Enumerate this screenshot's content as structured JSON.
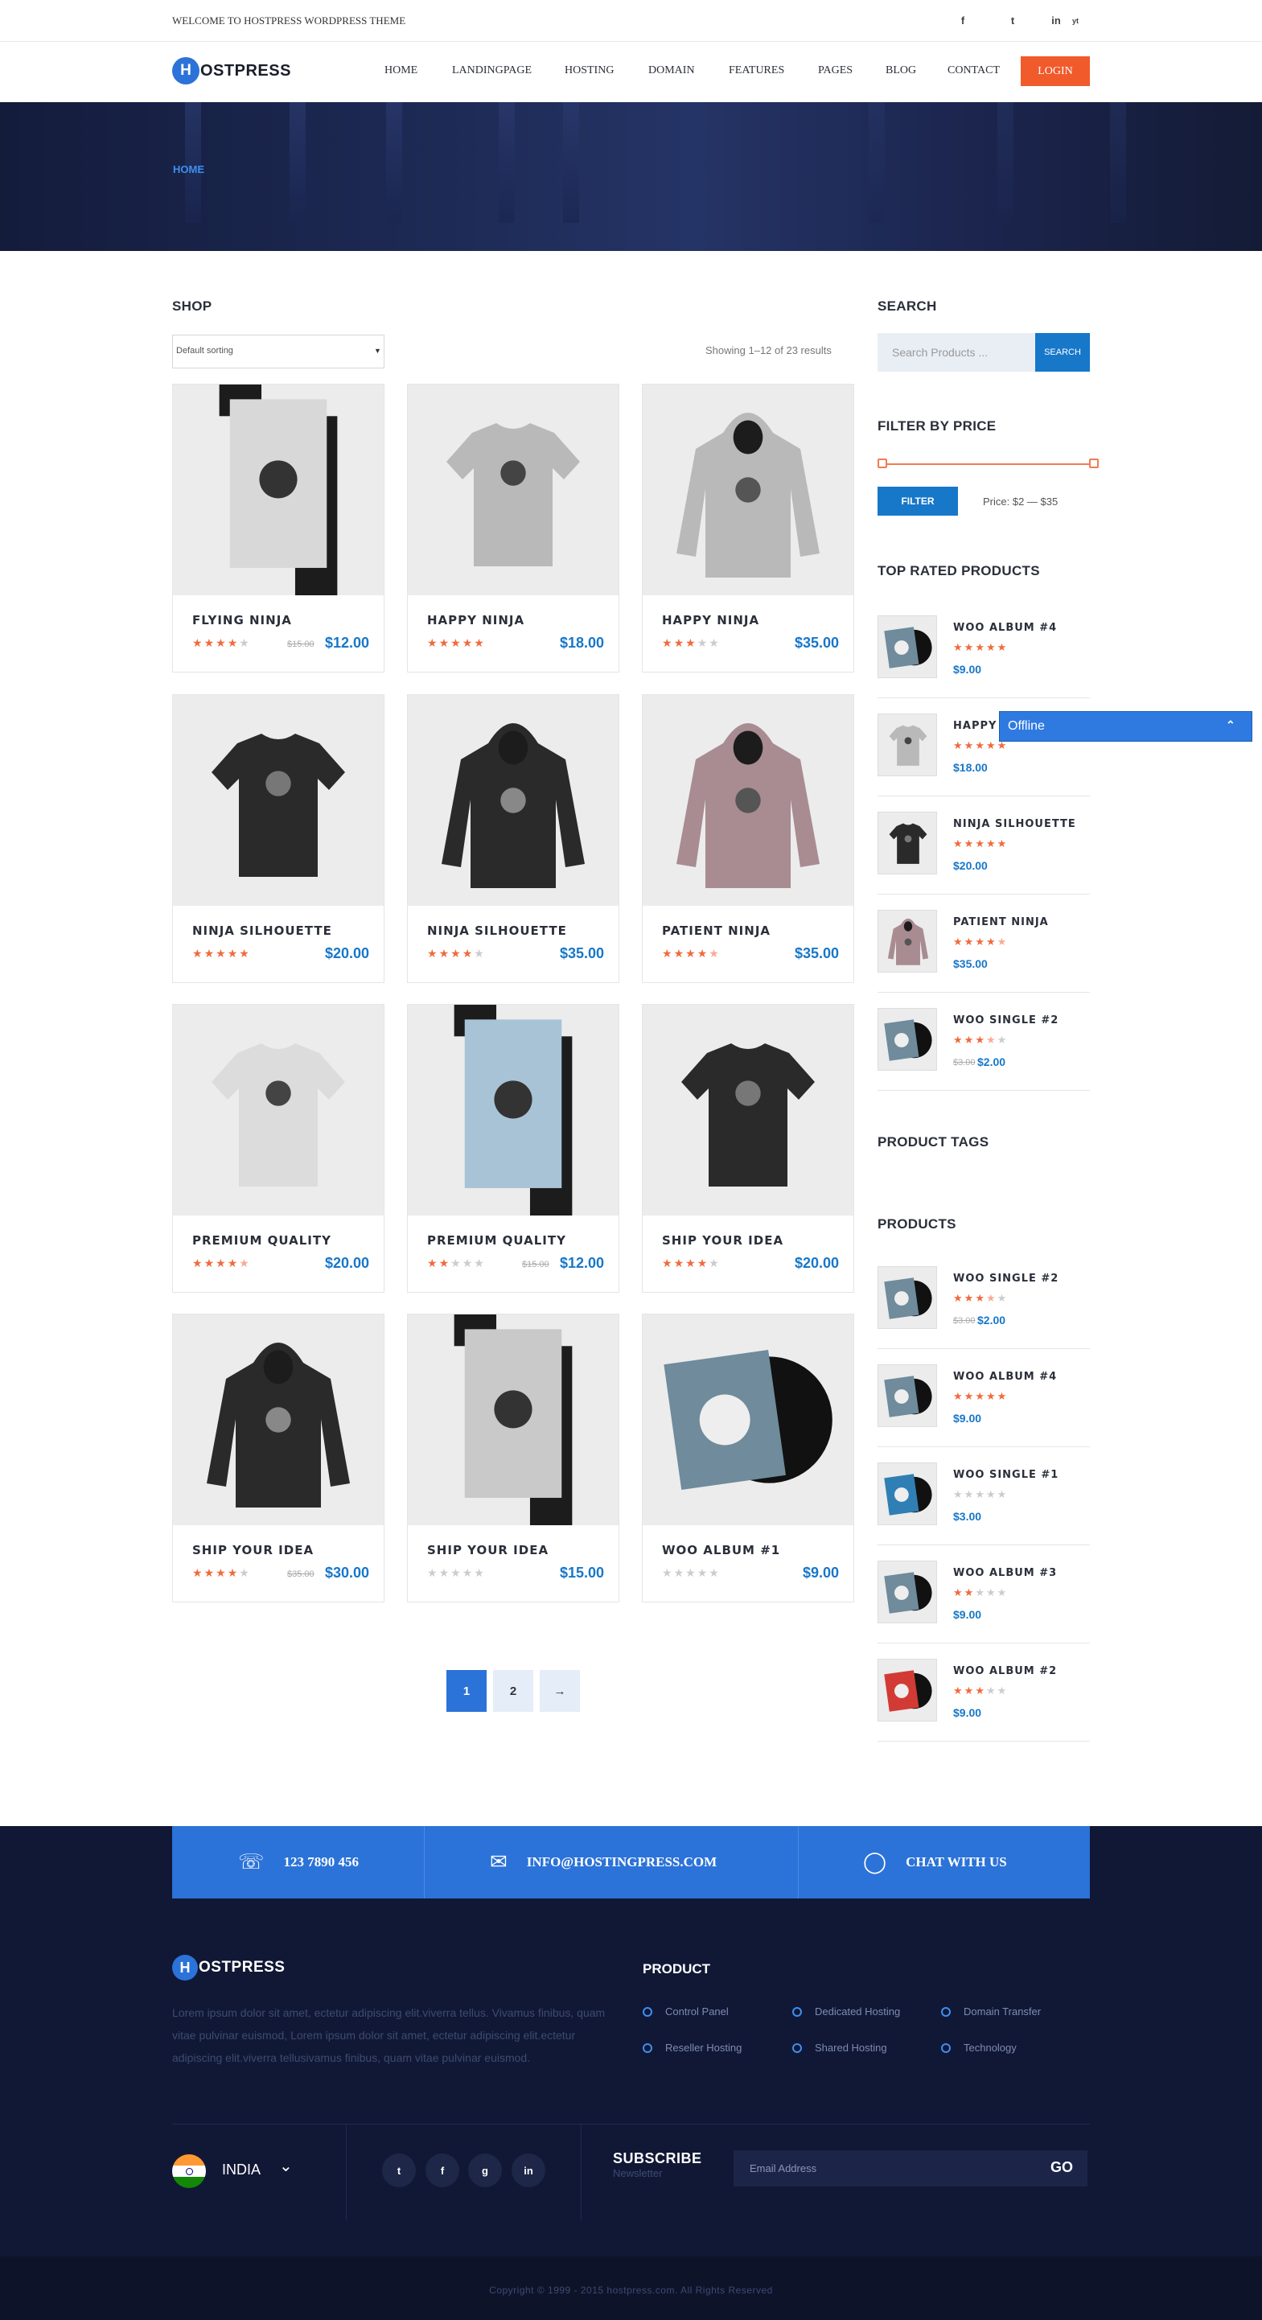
{
  "topbar": {
    "welcome": "WELCOME TO HOSTPRESS WORDPRESS THEME",
    "social": [
      "f",
      "t",
      "in",
      "yt"
    ]
  },
  "brand": {
    "initial": "H",
    "name": "OSTPRESS"
  },
  "nav": {
    "items": [
      "HOME",
      "LANDINGPAGE",
      "HOSTING",
      "DOMAIN",
      "FEATURES",
      "PAGES",
      "BLOG",
      "CONTACT"
    ],
    "login": "LOGIN"
  },
  "banner": {
    "breadcrumb": "HOME"
  },
  "shop": {
    "title": "SHOP",
    "sorting": "Default sorting",
    "showing": "Showing 1–12 of 23 results",
    "products": [
      {
        "name": "FLYING NINJA",
        "rating": 4,
        "old_price": "$15.00",
        "price": "$12.00",
        "image": "poster-ninja"
      },
      {
        "name": "HAPPY NINJA",
        "rating": 5,
        "old_price": "",
        "price": "$18.00",
        "image": "tshirt-grey"
      },
      {
        "name": "HAPPY NINJA",
        "rating": 3,
        "old_price": "",
        "price": "$35.00",
        "image": "hoodie-grey"
      },
      {
        "name": "NINJA SILHOUETTE",
        "rating": 5,
        "old_price": "",
        "price": "$20.00",
        "image": "tshirt-black"
      },
      {
        "name": "NINJA SILHOUETTE",
        "rating": 4,
        "old_price": "",
        "price": "$35.00",
        "image": "hoodie-black"
      },
      {
        "name": "PATIENT NINJA",
        "rating": 4.5,
        "old_price": "",
        "price": "$35.00",
        "image": "hoodie-pink"
      },
      {
        "name": "PREMIUM QUALITY",
        "rating": 4.5,
        "old_price": "",
        "price": "$20.00",
        "image": "tshirt-white"
      },
      {
        "name": "PREMIUM QUALITY",
        "rating": 2,
        "old_price": "$15.00",
        "price": "$12.00",
        "image": "poster-blue"
      },
      {
        "name": "SHIP YOUR IDEA",
        "rating": 4,
        "old_price": "",
        "price": "$20.00",
        "image": "tshirt-black-skull"
      },
      {
        "name": "SHIP YOUR IDEA",
        "rating": 4,
        "old_price": "$35.00",
        "price": "$30.00",
        "image": "hoodie-black-skull"
      },
      {
        "name": "SHIP YOUR IDEA",
        "rating": 0,
        "old_price": "",
        "price": "$15.00",
        "image": "poster-skull"
      },
      {
        "name": "WOO ALBUM #1",
        "rating": 0,
        "old_price": "",
        "price": "$9.00",
        "image": "album"
      }
    ],
    "pagination": [
      "1",
      "2",
      "→"
    ]
  },
  "sidebar": {
    "search_title": "SEARCH",
    "search_placeholder": "Search Products ...",
    "search_button": "SEARCH",
    "filter_title": "FILTER BY PRICE",
    "filter_button": "FILTER",
    "price_range": "Price: $2 — $35",
    "top_rated_title": "TOP RATED PRODUCTS",
    "top_rated": [
      {
        "name": "WOO ALBUM #4",
        "rating": 5,
        "old_price": "",
        "price": "$9.00",
        "image": "album"
      },
      {
        "name": "HAPPY NINJA",
        "rating": 5,
        "old_price": "",
        "price": "$18.00",
        "image": "tshirt-grey"
      },
      {
        "name": "NINJA SILHOUETTE",
        "rating": 5,
        "old_price": "",
        "price": "$20.00",
        "image": "tshirt-black"
      },
      {
        "name": "PATIENT NINJA",
        "rating": 4.5,
        "old_price": "",
        "price": "$35.00",
        "image": "hoodie-pink"
      },
      {
        "name": "WOO SINGLE #2",
        "rating": 3.5,
        "old_price": "$3.00",
        "price": "$2.00",
        "image": "album"
      }
    ],
    "tags_title": "PRODUCT TAGS",
    "products_title": "PRODUCTS",
    "products": [
      {
        "name": "WOO SINGLE #2",
        "rating": 3.5,
        "old_price": "$3.00",
        "price": "$2.00",
        "image": "album"
      },
      {
        "name": "WOO ALBUM #4",
        "rating": 5,
        "old_price": "",
        "price": "$9.00",
        "image": "album"
      },
      {
        "name": "WOO SINGLE #1",
        "rating": 0,
        "old_price": "",
        "price": "$3.00",
        "image": "album-blue"
      },
      {
        "name": "WOO ALBUM #3",
        "rating": 2,
        "old_price": "",
        "price": "$9.00",
        "image": "album"
      },
      {
        "name": "WOO ALBUM #2",
        "rating": 3,
        "old_price": "",
        "price": "$9.00",
        "image": "album-red"
      }
    ]
  },
  "chat_widget": {
    "status": "Offline"
  },
  "footer": {
    "phone": "123 7890 456",
    "email": "INFO@HOSTINGPRESS.COM",
    "chat": "CHAT WITH US",
    "about": "Lorem ipsum dolor sit amet, ectetur adipiscing elit.viverra tellus. Vivamus finibus, quam vitae pulvinar euismod, Lorem ipsum dolor sit amet, ectetur adipiscing elit.ectetur adipiscing elit.viverra tellusivamus finibus, quam vitae pulvinar euismod.",
    "product_title": "PRODUCT",
    "product_links": [
      "Control Panel",
      "Dedicated Hosting",
      "Domain Transfer",
      "Reseller Hosting",
      "Shared Hosting",
      "Technology"
    ],
    "country": "INDIA",
    "social": [
      "t",
      "f",
      "g",
      "in"
    ],
    "subscribe_title": "SUBSCRIBE",
    "subscribe_sub": "Newsletter",
    "email_placeholder": "Email Address",
    "go": "GO",
    "copyright": "Copyright © 1999 - 2015 hostpress.com. All Rights Reserved"
  },
  "colors": {
    "accent": "#2b73d8",
    "price": "#1777c9",
    "star": "#f06a3c",
    "login": "#f15a2b",
    "footer_bg": "#111835"
  }
}
